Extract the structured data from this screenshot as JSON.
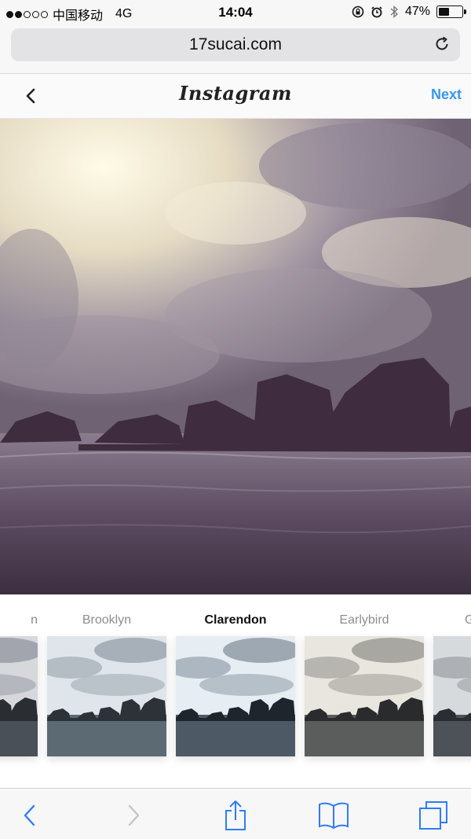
{
  "status_bar": {
    "carrier": "中国移动",
    "network": "4G",
    "time": "14:04",
    "battery_percent": "47%",
    "battery_level": 0.47,
    "signal_bars_filled": 2,
    "signal_bars_total": 5
  },
  "browser": {
    "url": "17sucai.com"
  },
  "header": {
    "logo": "Instagram",
    "next_label": "Next"
  },
  "filters": {
    "items": [
      {
        "label": "n",
        "selected": false
      },
      {
        "label": "Brooklyn",
        "selected": false
      },
      {
        "label": "Clarendon",
        "selected": true
      },
      {
        "label": "Earlybird",
        "selected": false
      },
      {
        "label": "G",
        "selected": false
      }
    ]
  },
  "colors": {
    "accent": "#3897f0",
    "toolbar_icon": "#2f7cf6",
    "toolbar_icon_disabled": "#c4c4c4"
  }
}
